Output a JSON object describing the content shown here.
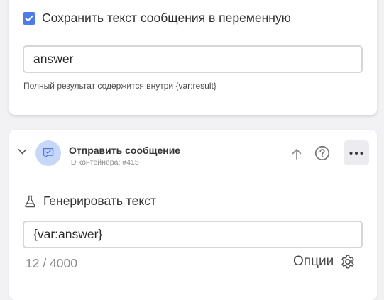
{
  "save_block": {
    "checkbox_checked": true,
    "checkbox_label": "Сохранить текст сообщения в переменную",
    "variable_value": "answer",
    "hint": "Полный результат содержится внутри {var:result}"
  },
  "send_block": {
    "title": "Отправить сообщение",
    "container_id": "ID контейнера: #415",
    "section_label": "Генерировать текст",
    "message_value": "{var:answer}",
    "counter": "12 / 4000",
    "options_label": "Опции"
  },
  "colors": {
    "accent": "#4f7be8",
    "avatar_bg": "#c7d7f7",
    "icon_gray": "#8a8a8a"
  },
  "icons": {
    "checkbox": "check-icon",
    "collapse": "chevron-down-icon",
    "block_type": "chat-bubble-icon",
    "move_up": "arrow-up-icon",
    "help": "question-circle-icon",
    "more": "more-horizontal-icon",
    "section": "flask-icon",
    "options": "gear-icon"
  }
}
